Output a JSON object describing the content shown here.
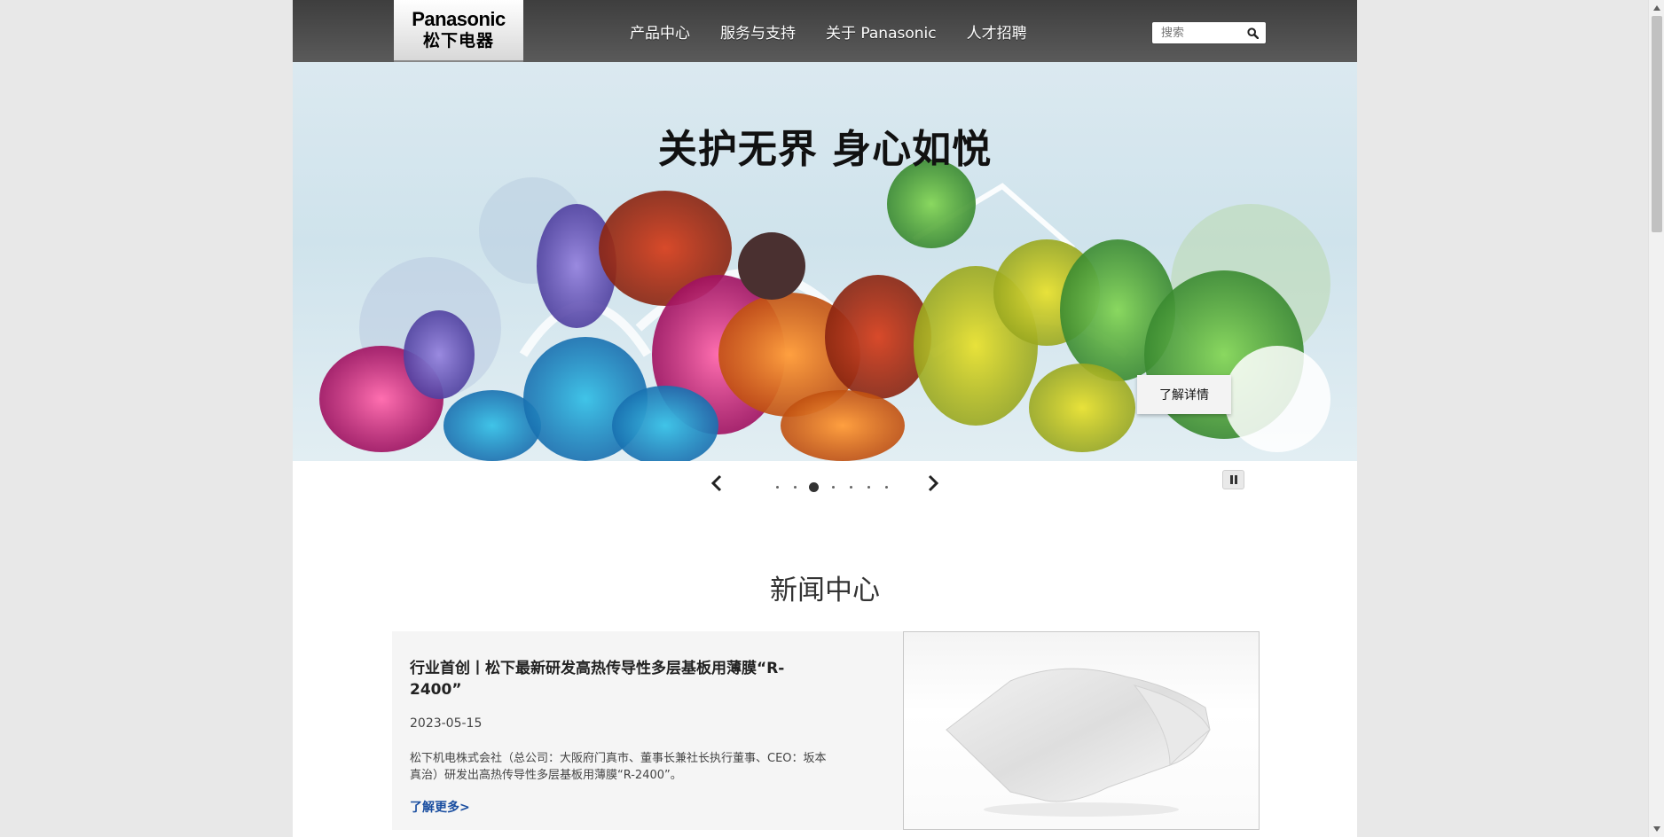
{
  "header": {
    "logo_brand": "Panasonic",
    "logo_brand_cn": "松下电器",
    "nav": [
      "产品中心",
      "服务与支持",
      "关于 Panasonic",
      "人才招聘"
    ],
    "search_placeholder": "搜索"
  },
  "hero": {
    "title": "关护无界 身心如悦",
    "cta_label": "了解详情"
  },
  "carousel": {
    "slide_count": 7,
    "active_index": 2
  },
  "news": {
    "section_title": "新闻中心",
    "headline": "行业首创丨松下最新研发高热传导性多层基板用薄膜“R-2400”",
    "date": "2023-05-15",
    "summary": "松下机电株式会社（总公司：大阪府门真市、董事长兼社长执行董事、CEO：坂本真治）研发出高热传导性多层基板用薄膜“R-2400”。",
    "more_label": "了解更多>"
  },
  "colors": {
    "header_bg": "#4a4a4a",
    "link_blue": "#1a4ea0",
    "page_bg": "#e8e8e8"
  }
}
